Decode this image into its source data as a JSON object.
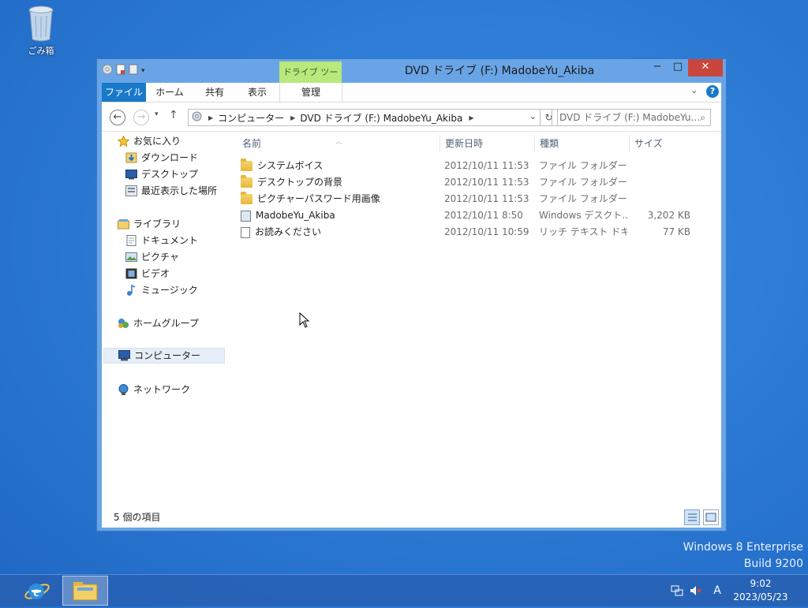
{
  "desktop": {
    "recycle_bin_label": "ごみ箱",
    "watermark_line1": "Windows 8 Enterprise",
    "watermark_line2": "Build 9200"
  },
  "window": {
    "title": "DVD ドライブ (F:) MadobeYu_Akiba",
    "contextual_tab_group": "ドライブ ツール",
    "controls": {
      "minimize": "−",
      "maximize": "□",
      "close": "✕"
    },
    "ribbon_tabs": [
      "ファイル",
      "ホーム",
      "共有",
      "表示",
      "管理"
    ],
    "address": {
      "breadcrumb": [
        "コンピューター",
        "DVD ドライブ (F:) MadobeYu_Akiba"
      ],
      "search_placeholder": "DVD ドライブ (F:) MadobeYu..."
    },
    "nav_pane": {
      "favorites": {
        "label": "お気に入り",
        "items": [
          "ダウンロード",
          "デスクトップ",
          "最近表示した場所"
        ]
      },
      "libraries": {
        "label": "ライブラリ",
        "items": [
          "ドキュメント",
          "ピクチャ",
          "ビデオ",
          "ミュージック"
        ]
      },
      "homegroup": "ホームグループ",
      "computer": "コンピューター",
      "network": "ネットワーク"
    },
    "columns": [
      "名前",
      "更新日時",
      "種類",
      "サイズ"
    ],
    "files": [
      {
        "name": "システムボイス",
        "date": "2012/10/11 11:53",
        "type": "ファイル フォルダー",
        "size": "",
        "icon": "folder-icon"
      },
      {
        "name": "デスクトップの背景",
        "date": "2012/10/11 11:53",
        "type": "ファイル フォルダー",
        "size": "",
        "icon": "folder-icon"
      },
      {
        "name": "ピクチャーパスワード用画像",
        "date": "2012/10/11 11:53",
        "type": "ファイル フォルダー",
        "size": "",
        "icon": "folder-icon"
      },
      {
        "name": "MadobeYu_Akiba",
        "date": "2012/10/11 8:50",
        "type": "Windows デスクト...",
        "size": "3,202 KB",
        "icon": "application-icon"
      },
      {
        "name": "お読みください",
        "date": "2012/10/11 10:59",
        "type": "リッチ テキスト ドキュ...",
        "size": "77 KB",
        "icon": "document-icon"
      }
    ],
    "status": "5 個の項目"
  },
  "taskbar": {
    "input_indicator": "A",
    "time": "9:02",
    "date": "2023/05/23"
  },
  "colors": {
    "accent": "#1979ca",
    "close": "#c9463d",
    "context_tab": "#b9e87c",
    "frame": "#69a5e6"
  }
}
